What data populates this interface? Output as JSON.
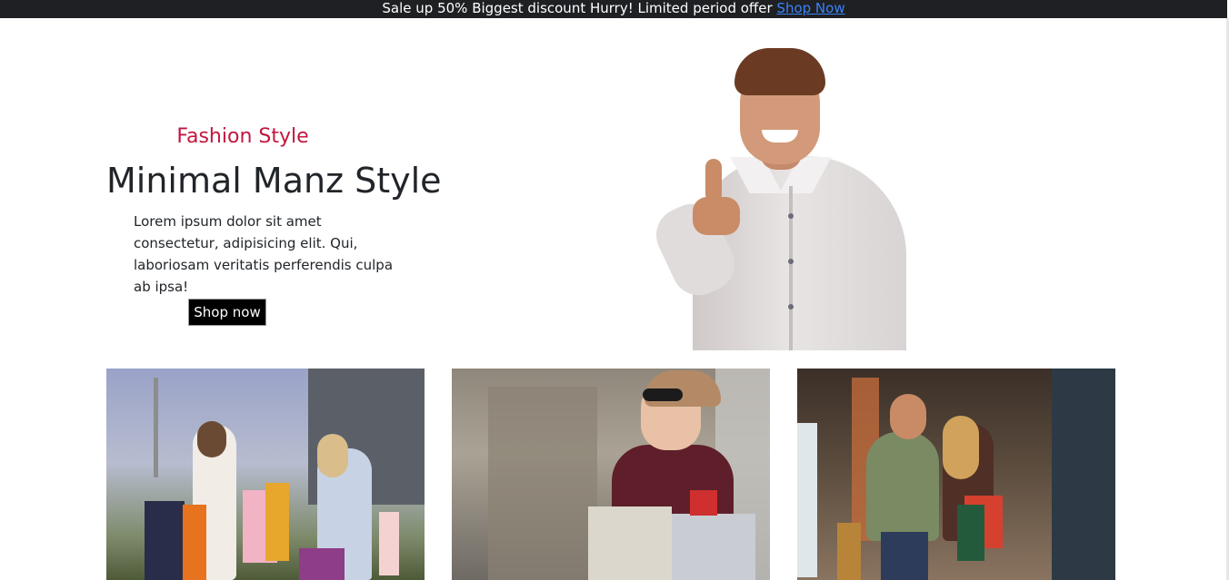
{
  "announcement": {
    "text": "Sale up 50% Biggest discount Hurry! Limited period offer ",
    "link_label": "Shop Now"
  },
  "hero": {
    "eyebrow": "Fashion Style",
    "title": "Minimal Manz Style",
    "description": "Lorem ipsum dolor sit amet consectetur, adipisicing elit. Qui, laboriosam veritatis perferendis culpa ab ipsa!",
    "button_label": "Shop now",
    "image": "smiling-man-thumbs-up"
  },
  "cards": [
    {
      "image": "two-women-with-shopping-bags"
    },
    {
      "image": "woman-with-sunglasses-holding-shopping-bags"
    },
    {
      "image": "couple-walking-in-mall-with-shopping-bags"
    }
  ],
  "colors": {
    "topbar_bg": "#1f2023",
    "link": "#3b82f6",
    "eyebrow": "#c3163f",
    "button_bg": "#000000"
  }
}
